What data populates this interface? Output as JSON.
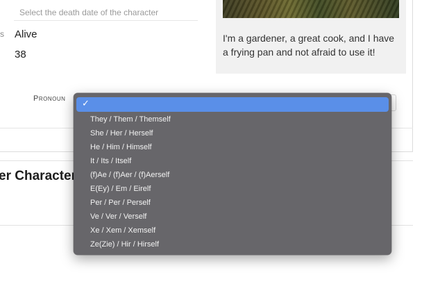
{
  "form": {
    "death_date_placeholder": "Select the death date of the character",
    "status_label_fragment": "s",
    "status_value": "Alive",
    "age_value": "38",
    "pronoun_label": "Pronoun"
  },
  "bio": {
    "text": "I'm a gardener, a great cook, and I have a frying pan and not afraid to use it!"
  },
  "section": {
    "heading_fragment": "er Character"
  },
  "dropdown": {
    "check_glyph": "✓",
    "options": [
      "They / Them / Themself",
      "She / Her / Herself",
      "He / Him / Himself",
      "It / Its / Itself",
      "(f)Ae / (f)Aer / (f)Aerself",
      "E(Ey) / Em / Eirelf",
      "Per / Per / Perself",
      "Ve / Ver / Verself",
      "Xe / Xem / Xemself",
      "Ze(Zie) / Hir / Hirself"
    ]
  },
  "colors": {
    "menu_bg": "#67666a",
    "menu_selected": "#5a8fe8",
    "menu_text": "#f2f2f2"
  }
}
